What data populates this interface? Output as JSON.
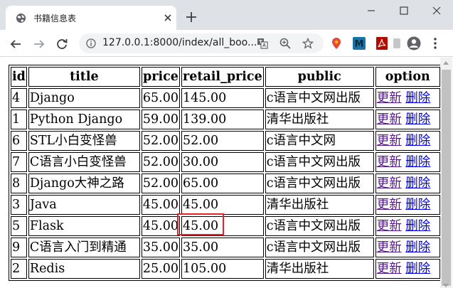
{
  "browser": {
    "tab_title": "书籍信息表",
    "url": "127.0.0.1:8000/index/all_boo...",
    "icons": {
      "favicon": "globe-icon",
      "close": "close-icon",
      "new_tab": "plus-icon",
      "back": "back-arrow-icon",
      "forward": "forward-arrow-icon",
      "reload": "reload-icon",
      "info": "info-icon",
      "translate": "translate-icon",
      "zoom": "zoom-icon",
      "bookmark": "star-icon",
      "profile": "avatar-icon",
      "menu": "kebab-menu-icon"
    },
    "extensions": [
      {
        "name": "location-pin-ext",
        "color": "#e8453c"
      },
      {
        "name": "m-ext",
        "color": "#1a73a8",
        "letter": "M"
      },
      {
        "name": "pdf-ext",
        "color": "#b30b00"
      },
      {
        "name": "gray-ext",
        "color": "#c5c7c9"
      }
    ]
  },
  "table": {
    "headers": [
      "id",
      "title",
      "price",
      "retail_price",
      "public",
      "option"
    ],
    "rows": [
      {
        "id": "4",
        "title": "Django",
        "price": "65.00",
        "retail_price": "145.00",
        "public": "c语言中文网出版",
        "edit": "更新",
        "delete": "删除",
        "edit_visited": true
      },
      {
        "id": "1",
        "title": "Python Django",
        "price": "59.00",
        "retail_price": "139.00",
        "public": "清华出版社",
        "edit": "更新",
        "delete": "删除",
        "edit_visited": true
      },
      {
        "id": "6",
        "title": "STL小白变怪兽",
        "price": "52.00",
        "retail_price": "52.00",
        "public": "c语言中文网",
        "edit": "更新",
        "delete": "删除",
        "edit_visited": true
      },
      {
        "id": "7",
        "title": "C语言小白变怪兽",
        "price": "52.00",
        "retail_price": "30.00",
        "public": "c语言中文网出版",
        "edit": "更新",
        "delete": "删除",
        "edit_visited": true
      },
      {
        "id": "8",
        "title": "Django大神之路",
        "price": "52.00",
        "retail_price": "65.00",
        "public": "c语言中文网出版",
        "edit": "更新",
        "delete": "删除",
        "edit_visited": true
      },
      {
        "id": "3",
        "title": "Java",
        "price": "45.00",
        "retail_price": "45.00",
        "public": "清华出版社",
        "edit": "更新",
        "delete": "删除",
        "edit_visited": true
      },
      {
        "id": "5",
        "title": "Flask",
        "price": "45.00",
        "retail_price": "45.00",
        "public": "c语言中文网出版",
        "edit": "更新",
        "delete": "删除",
        "edit_visited": true
      },
      {
        "id": "9",
        "title": "C语言入门到精通",
        "price": "35.00",
        "retail_price": "35.00",
        "public": "c语言中文网出版",
        "edit": "更新",
        "delete": "删除",
        "edit_visited": true
      },
      {
        "id": "2",
        "title": "Redis",
        "price": "25.00",
        "retail_price": "105.00",
        "public": "清华出版社",
        "edit": "更新",
        "delete": "删除",
        "edit_visited": true
      }
    ]
  },
  "colors": {
    "link": "#0000ee",
    "link_visited": "#551a8b",
    "highlight_box": "#e0242a"
  }
}
